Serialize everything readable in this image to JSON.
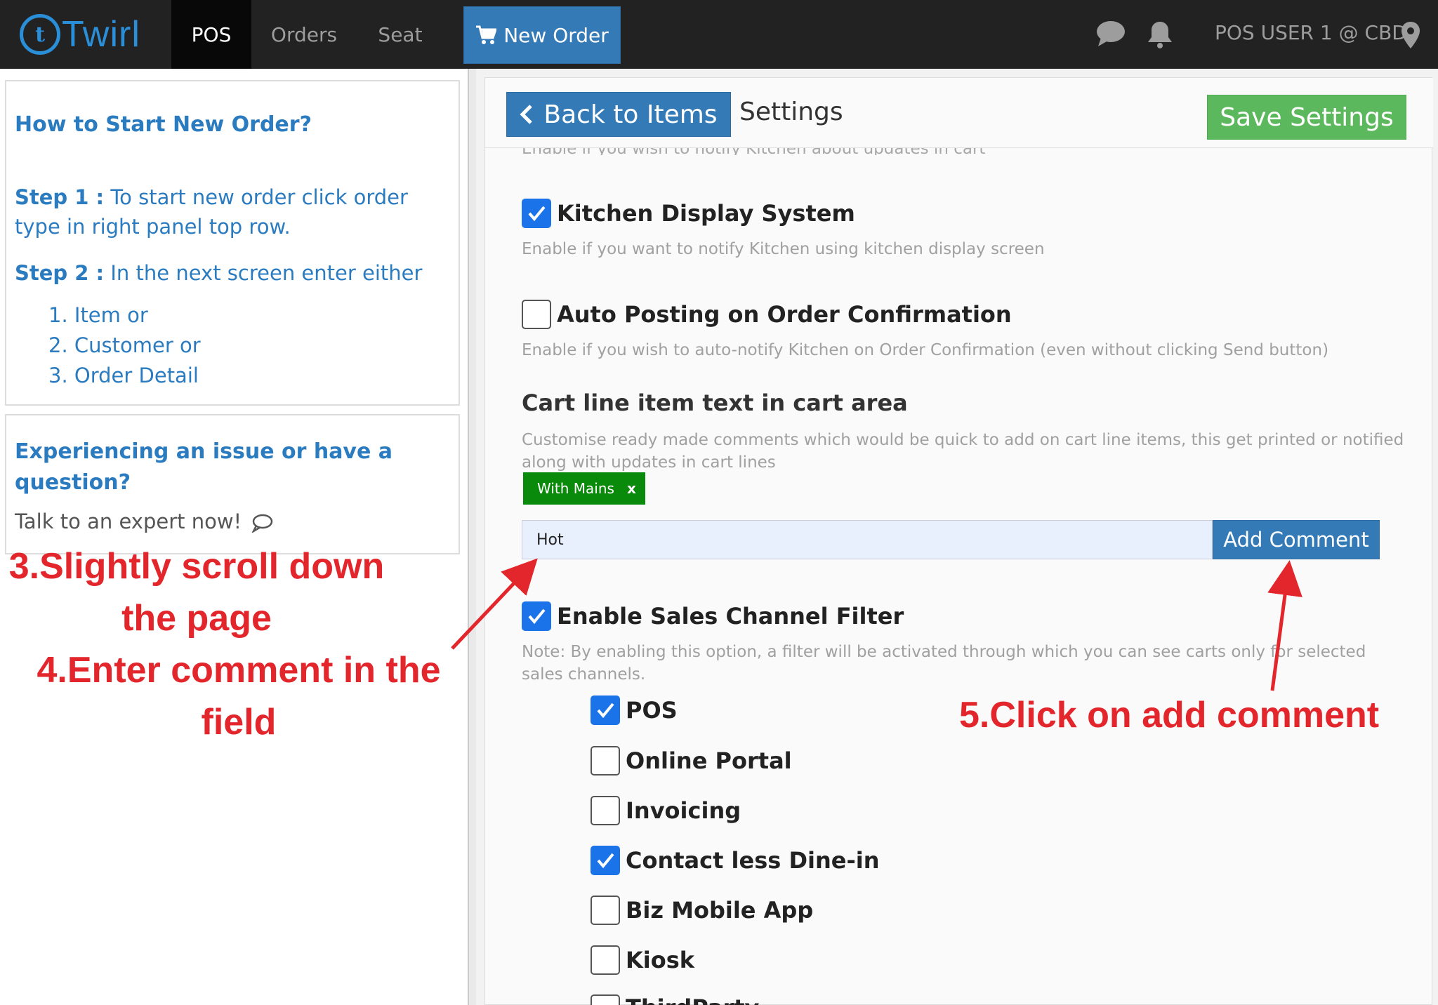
{
  "navbar": {
    "logo_text": "Twirl",
    "logo_mark": "t",
    "tabs": [
      {
        "label": "POS",
        "active": true
      },
      {
        "label": "Orders",
        "active": false
      },
      {
        "label": "Seat",
        "active": false
      }
    ],
    "new_order_label": "New Order",
    "user_label": "POS USER 1 @ CBD",
    "icons": [
      "chat-icon",
      "bell-icon",
      "map-pin-icon",
      "cart-icon"
    ]
  },
  "sidebar": {
    "help_title": "How to Start New Order?",
    "step1_label": "Step 1 :",
    "step1_text": " To start new order click order type in right panel top row.",
    "step2_label": "Step 2 :",
    "step2_text": " In the next screen enter either",
    "sub_items": [
      "1. Item or",
      "2. Customer or",
      "3. Order Detail"
    ],
    "issue_title": "Experiencing an issue or have a question?",
    "expert_text": "Talk to an expert now!"
  },
  "annotations": {
    "step3": "3.Slightly scroll down the page",
    "step4": "4.Enter comment in the field",
    "step5": "5.Click on add comment",
    "color": "#e3262b"
  },
  "settings": {
    "back_label": "Back to Items",
    "title": "Settings",
    "save_label": "Save Settings",
    "cut_text": "Enable if you wish to notify Kitchen about updates in cart",
    "kds": {
      "label": "Kitchen Display System",
      "checked": true,
      "desc": "Enable if you want to notify Kitchen using kitchen display screen"
    },
    "auto_post": {
      "label": "Auto Posting on Order Confirmation",
      "checked": false,
      "desc": "Enable if you wish to auto-notify Kitchen on Order Confirmation (even without clicking Send button)"
    },
    "cart_line": {
      "title": "Cart line item text in cart area",
      "desc": "Customise ready made comments which would be quick to add on cart line items, this get printed or notified along with updates in cart lines",
      "tags": [
        {
          "label": "With Mains",
          "remove": "x"
        }
      ],
      "input_value": "Hot",
      "add_label": "Add Comment"
    },
    "sales_channel": {
      "label": "Enable Sales Channel Filter",
      "checked": true,
      "desc": "Note: By enabling this option, a filter will be activated through which you can see carts only for selected sales channels.",
      "channels": [
        {
          "label": "POS",
          "checked": true
        },
        {
          "label": "Online Portal",
          "checked": false
        },
        {
          "label": "Invoicing",
          "checked": false
        },
        {
          "label": "Contact less Dine-in",
          "checked": true
        },
        {
          "label": "Biz Mobile App",
          "checked": false
        },
        {
          "label": "Kiosk",
          "checked": false
        },
        {
          "label": "ThirdParty",
          "checked": false
        }
      ]
    }
  },
  "colors": {
    "navbar": "#222222",
    "primary": "#337ab7",
    "success": "#5cb85c",
    "tag": "#0a8a0a",
    "checkbox": "#1a73e8",
    "link": "#2a7bbf"
  }
}
